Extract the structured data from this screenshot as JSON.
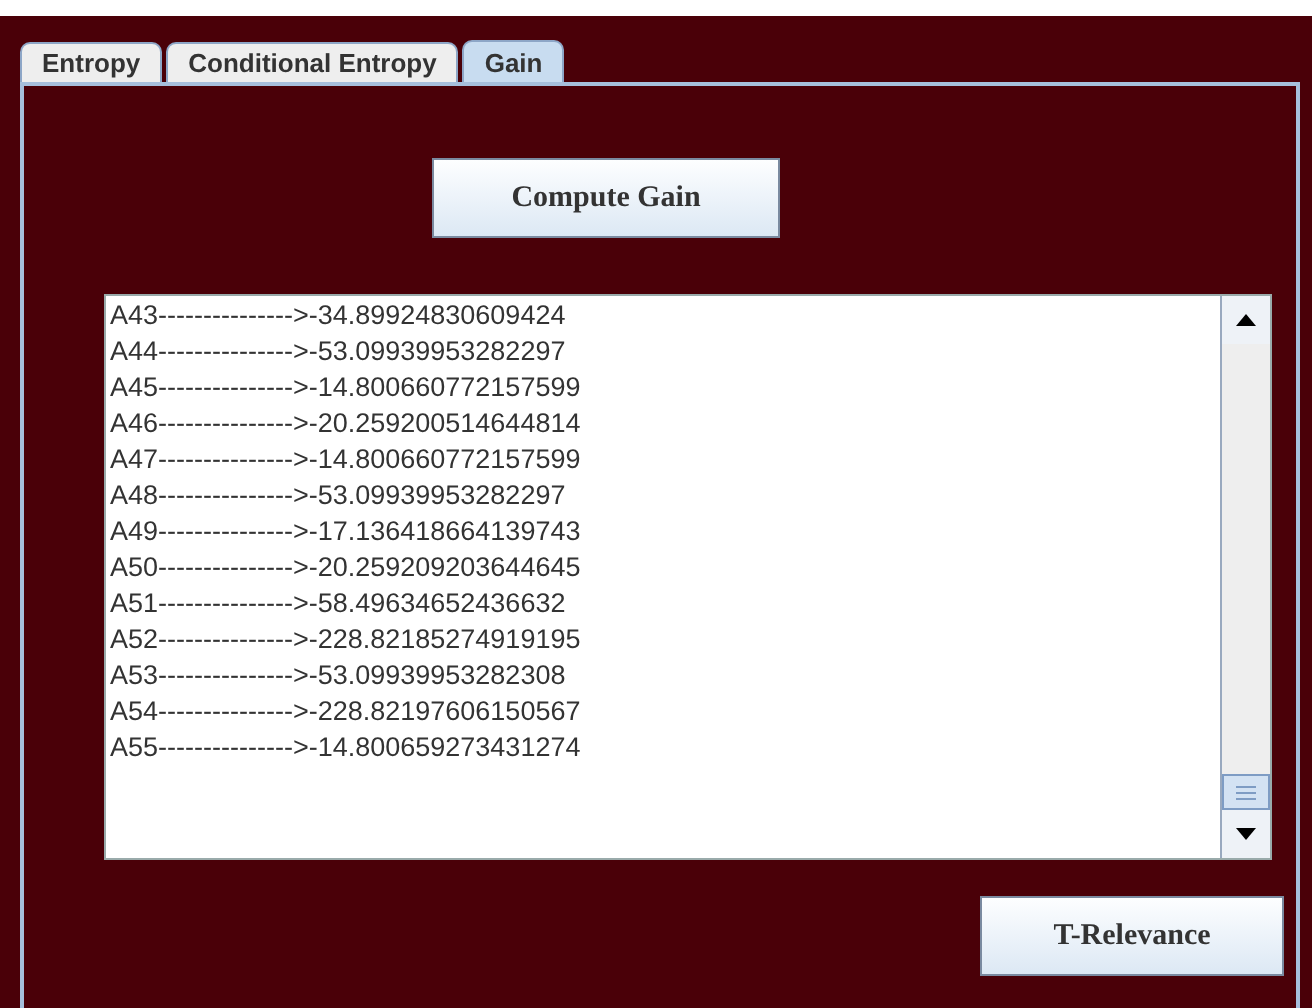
{
  "tabs": [
    {
      "label": "Entropy",
      "selected": false
    },
    {
      "label": "Conditional Entropy",
      "selected": false
    },
    {
      "label": "Gain",
      "selected": true
    }
  ],
  "compute_button": "Compute Gain",
  "results": [
    "A43--------------->-34.89924830609424",
    "A44--------------->-53.09939953282297",
    "A45--------------->-14.800660772157599",
    "A46--------------->-20.259200514644814",
    "A47--------------->-14.800660772157599",
    "A48--------------->-53.09939953282297",
    "A49--------------->-17.136418664139743",
    "A50--------------->-20.259209203644645",
    "A51--------------->-58.49634652436632",
    "A52--------------->-228.82185274919195",
    "A53--------------->-53.09939953282308",
    "A54--------------->-228.82197606150567",
    "A55--------------->-14.800659273431274"
  ],
  "relevance_button": "T-Relevance"
}
